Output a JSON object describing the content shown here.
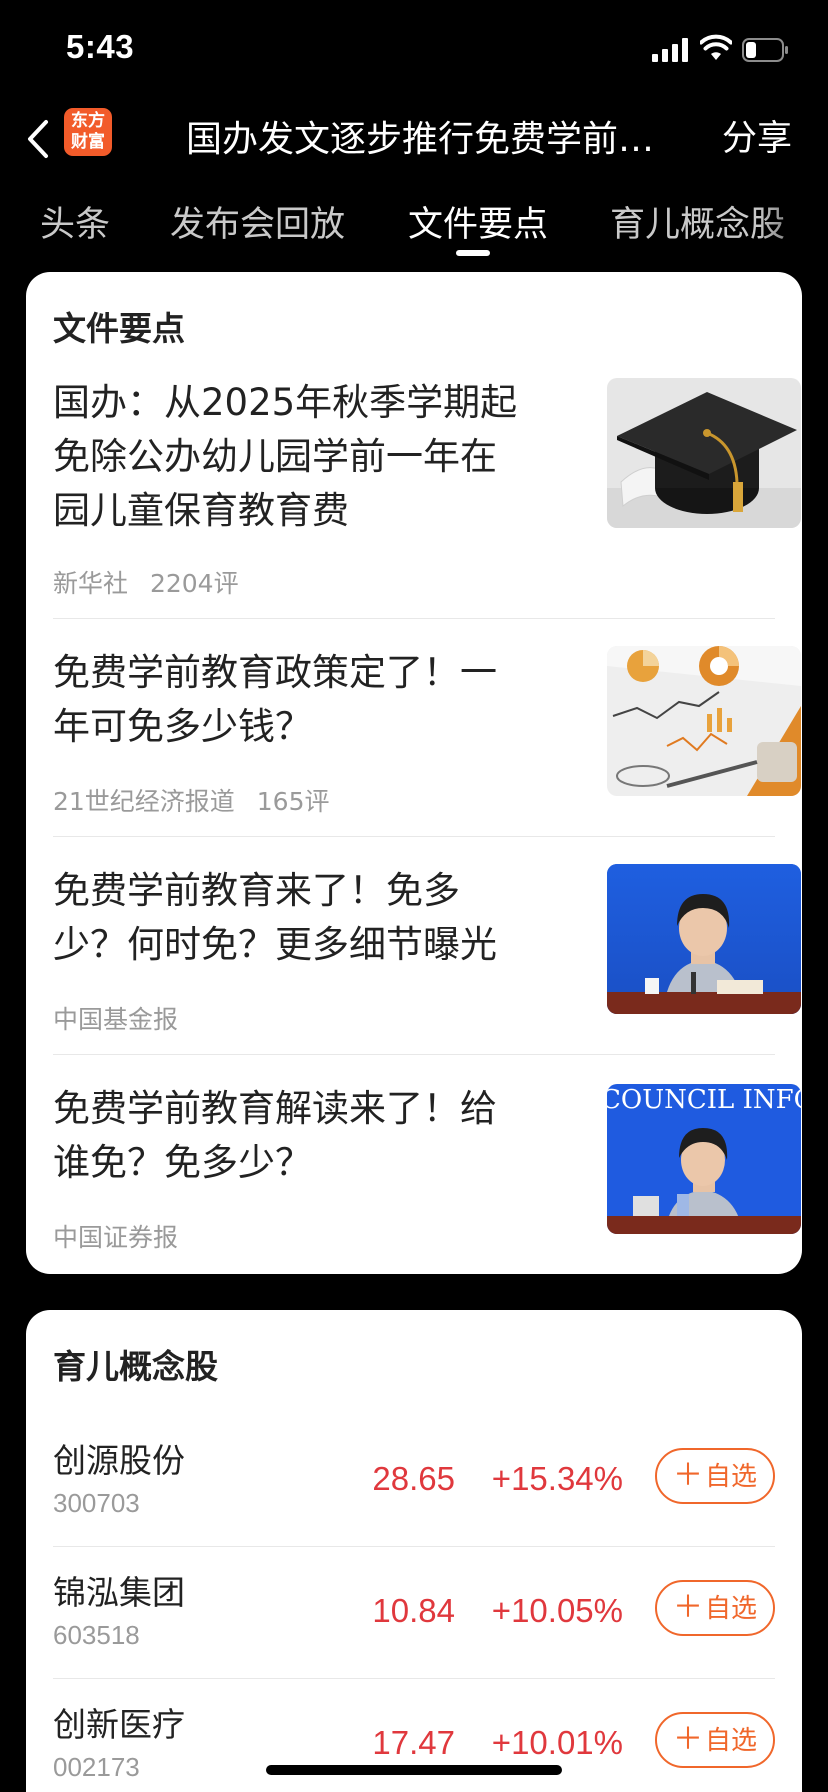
{
  "status_bar": {
    "time": "5:43"
  },
  "nav": {
    "logo_line1": "东方",
    "logo_line2": "财富",
    "title": "国办发文逐步推行免费学前…",
    "share_label": "分享"
  },
  "tabs": [
    {
      "label": "头条"
    },
    {
      "label": "发布会回放"
    },
    {
      "label": "文件要点"
    },
    {
      "label": "育儿概念股"
    }
  ],
  "files_card": {
    "title": "文件要点",
    "items": [
      {
        "title": "国办：从2025年秋季学期起免除公办幼儿园学前一年在园儿童保育教育费",
        "source": "新华社",
        "comments": "2204评",
        "thumb": "graduation-cap-photo"
      },
      {
        "title": "免费学前教育政策定了！一年可免多少钱？",
        "source": "21世纪经济报道",
        "comments": "165评",
        "thumb": "financial-charts-photo"
      },
      {
        "title": "免费学前教育来了！免多少？何时免？更多细节曝光",
        "source": "中国基金报",
        "comments": "",
        "thumb": "press-conference-speaker-photo"
      },
      {
        "title": "免费学前教育解读来了！给谁免？免多少？",
        "source": "中国证券报",
        "comments": "",
        "thumb": "press-conference-speaker-photo",
        "thumb_text": "COUNCIL INFORM"
      }
    ]
  },
  "stocks_card": {
    "title": "育儿概念股",
    "watch_label": "自选",
    "items": [
      {
        "name": "创源股份",
        "code": "300703",
        "price": "28.65",
        "change": "+15.34%"
      },
      {
        "name": "锦泓集团",
        "code": "603518",
        "price": "10.84",
        "change": "+10.05%"
      },
      {
        "name": "创新医疗",
        "code": "002173",
        "price": "17.47",
        "change": "+10.01%"
      }
    ]
  },
  "colors": {
    "accent": "#f0672b",
    "up": "#e0383d",
    "background": "#000000",
    "card": "#ffffff"
  }
}
